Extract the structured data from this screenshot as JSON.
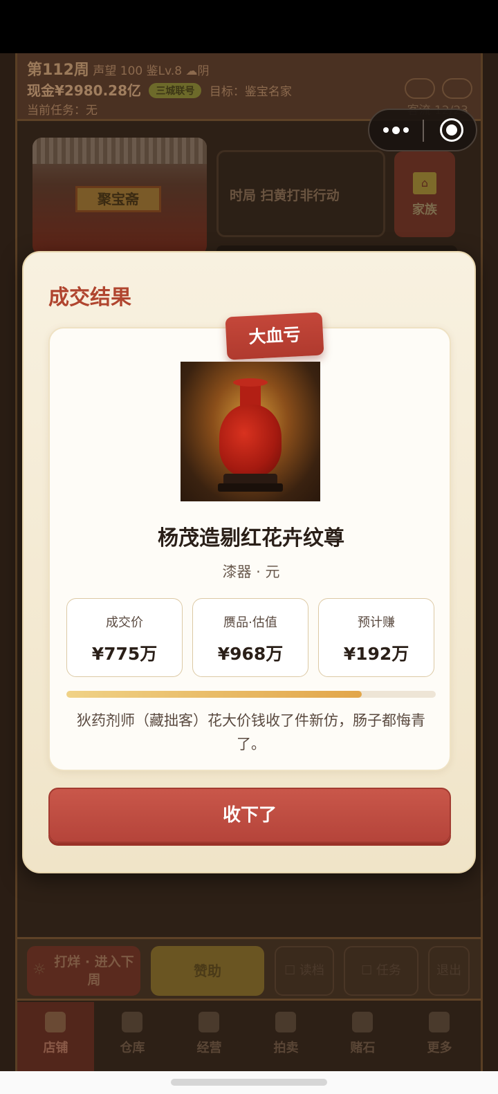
{
  "hud": {
    "week": "第112周",
    "reputation": "声望 100",
    "level": "鉴Lv.8",
    "weather": "阴",
    "cash": "现金¥2980.28亿",
    "pill": "三城联号",
    "goal": "目标：鉴宝名家",
    "task": "当前任务：无",
    "guests": "客流 12/23"
  },
  "shop": {
    "sign": "聚宝斋",
    "era": "时局 扫黄打非行动",
    "clan_label": "家族"
  },
  "modal": {
    "title": "成交结果",
    "badge": "大血亏",
    "item_name": "杨茂造剔红花卉纹尊",
    "item_sub": "漆器 · 元",
    "stats": [
      {
        "label": "成交价",
        "value": "¥775万"
      },
      {
        "label": "赝品·估值",
        "value": "¥968万"
      },
      {
        "label": "预计赚",
        "value": "¥192万"
      }
    ],
    "progress": 0.8,
    "description": "狄药剂师（藏拙客）花大价钱收了件新仿，肠子都悔青了。",
    "confirm_label": "收下了"
  },
  "actions": {
    "next_week": "打烊 · 进入下周",
    "sponsor": "赞助",
    "ghost": [
      "☐ 读档",
      "☐ 任务",
      "退出"
    ]
  },
  "tabs": [
    "店铺",
    "仓库",
    "经营",
    "拍卖",
    "赌石",
    "更多"
  ],
  "colors": {
    "accent": "#b0452f",
    "confirm": "#c4473a",
    "progress": "#e2a64a",
    "modal_bg": "#f8f1e0"
  }
}
